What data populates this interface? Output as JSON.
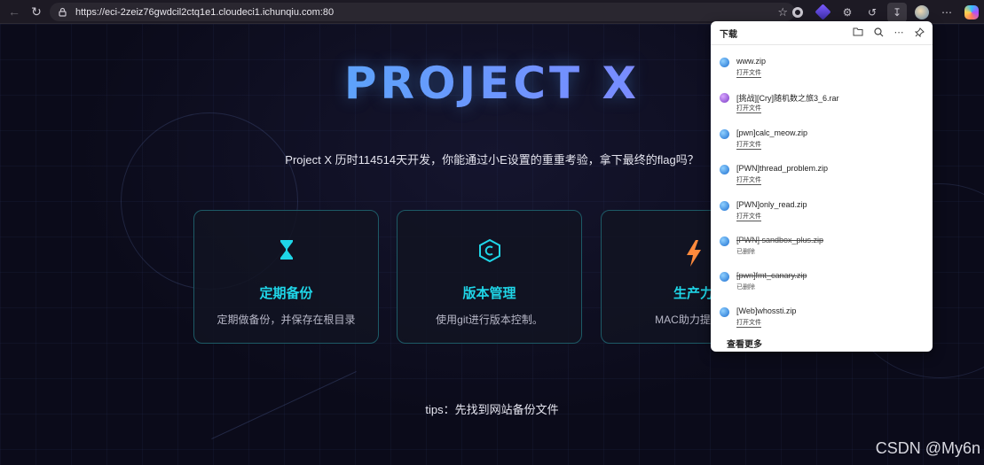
{
  "browser": {
    "url": "https://eci-2zeiz76gwdcil2ctq1e1.cloudeci1.ichunqiu.com:80"
  },
  "hero": {
    "title": "PROJECT X",
    "subtitle": "Project X 历时114514天开发，你能通过小E设置的重重考验，拿下最终的flag吗？"
  },
  "cards": [
    {
      "title": "定期备份",
      "desc": "定期做备份，并保存在根目录",
      "icon": "hourglass-icon",
      "color": "#1fd6e8"
    },
    {
      "title": "版本管理",
      "desc": "使用git进行版本控制。",
      "icon": "hexagon-c-icon",
      "color": "#1fd6e8"
    },
    {
      "title": "生产力",
      "desc": "MAC助力提升开",
      "icon": "lightning-icon",
      "color": "#ff8a3c"
    }
  ],
  "tips": "tips：先找到网站备份文件",
  "watermark": "CSDN @My6n",
  "downloads": {
    "title": "下载",
    "items": [
      {
        "name": "www.zip",
        "action": "打开文件",
        "deleted": false,
        "icon": "blue"
      },
      {
        "name": "[挑战][Cry]随机数之旅3_6.rar",
        "action": "打开文件",
        "deleted": false,
        "icon": "purple"
      },
      {
        "name": "[pwn]calc_meow.zip",
        "action": "打开文件",
        "deleted": false,
        "icon": "blue"
      },
      {
        "name": "[PWN]thread_problem.zip",
        "action": "打开文件",
        "deleted": false,
        "icon": "blue"
      },
      {
        "name": "[PWN]only_read.zip",
        "action": "打开文件",
        "deleted": false,
        "icon": "blue"
      },
      {
        "name": "[PWN] sandbox_plus.zip",
        "action": "已删除",
        "deleted": true,
        "icon": "blue"
      },
      {
        "name": "[pwn]fmt_canary.zip",
        "action": "已删除",
        "deleted": true,
        "icon": "blue"
      },
      {
        "name": "[Web]whossti.zip",
        "action": "打开文件",
        "deleted": false,
        "icon": "blue"
      }
    ],
    "more_label": "查看更多"
  }
}
